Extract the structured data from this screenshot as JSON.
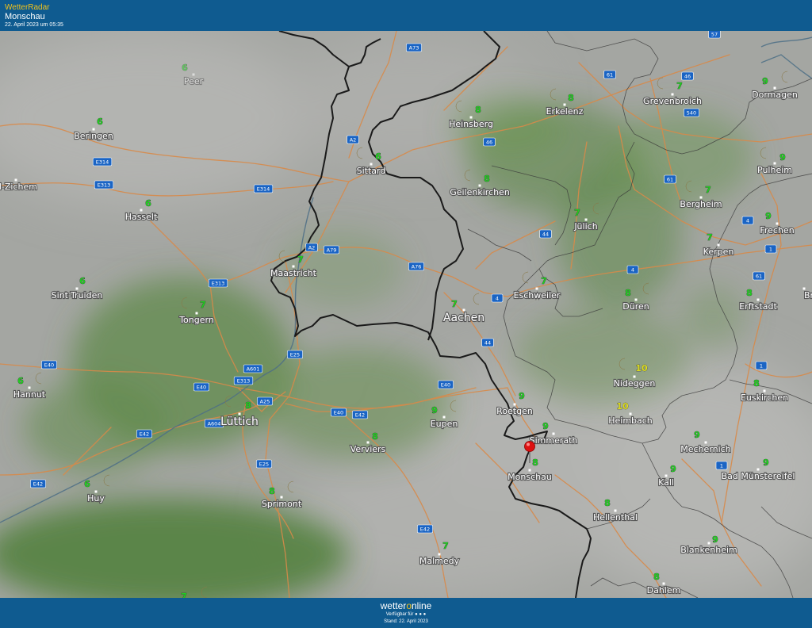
{
  "header": {
    "app_title": "WetterRadar",
    "location": "Monschau",
    "timestamp": "22. April 2023 um 05:35"
  },
  "footer": {
    "brand_prefix": "wetter",
    "brand_accent": "o",
    "brand_suffix": "nline",
    "availability": "Verfügbar für",
    "stand": "Stand: 22. April 2023"
  },
  "colors": {
    "header_bg": "#0f5b90",
    "brand_accent": "#f2c21b",
    "temp_green": "#22cc22",
    "temp_yellow": "#dddd22",
    "moon": "#f1d27a",
    "pin": "#dd1111",
    "road": "#d88a4a",
    "road_shield": "#1a64c4"
  },
  "cities": [
    {
      "name": "Peer",
      "temp": "6"
    },
    {
      "name": "Beringen",
      "temp": "6"
    },
    {
      "name": "l-Zichem",
      "temp": ""
    },
    {
      "name": "Hasselt",
      "temp": "6"
    },
    {
      "name": "Sint-Truiden",
      "temp": "6"
    },
    {
      "name": "Tongern",
      "temp": "7"
    },
    {
      "name": "Hannut",
      "temp": "6"
    },
    {
      "name": "Huy",
      "temp": "6"
    },
    {
      "name": "Lüttich",
      "temp": "8"
    },
    {
      "name": "Sprimont",
      "temp": "8"
    },
    {
      "name": "Verviers",
      "temp": "8"
    },
    {
      "name": "Maastricht",
      "temp": "7"
    },
    {
      "name": "Sittard",
      "temp": "6"
    },
    {
      "name": "Heinsberg",
      "temp": "8"
    },
    {
      "name": "Geilenkirchen",
      "temp": "8"
    },
    {
      "name": "Erkelenz",
      "temp": "8"
    },
    {
      "name": "Grevenbroich",
      "temp": "7"
    },
    {
      "name": "Dormagen",
      "temp": "9"
    },
    {
      "name": "Pulheim",
      "temp": "9"
    },
    {
      "name": "Bergheim",
      "temp": "7"
    },
    {
      "name": "Jülich",
      "temp": "7"
    },
    {
      "name": "Frechen",
      "temp": "9"
    },
    {
      "name": "Kerpen",
      "temp": "7"
    },
    {
      "name": "Aachen",
      "temp": "7"
    },
    {
      "name": "Eschweiler",
      "temp": "7"
    },
    {
      "name": "Düren",
      "temp": "8"
    },
    {
      "name": "Erftstadt",
      "temp": "8"
    },
    {
      "name": "Br",
      "temp": ""
    },
    {
      "name": "Nideggen",
      "temp": "10"
    },
    {
      "name": "Euskirchen",
      "temp": "8"
    },
    {
      "name": "Roetgen",
      "temp": "9"
    },
    {
      "name": "Eupen",
      "temp": "9"
    },
    {
      "name": "Simmerath",
      "temp": "9"
    },
    {
      "name": "Heimbach",
      "temp": "10"
    },
    {
      "name": "Monschau",
      "temp": "8"
    },
    {
      "name": "Mechernich",
      "temp": "9"
    },
    {
      "name": "Kall",
      "temp": "9"
    },
    {
      "name": "Bad Münstereifel",
      "temp": "9"
    },
    {
      "name": "Hellenthal",
      "temp": "8"
    },
    {
      "name": "Blankenheim",
      "temp": "9"
    },
    {
      "name": "Malmedy",
      "temp": "7"
    },
    {
      "name": "Dahlem",
      "temp": "8"
    },
    {
      "name": "",
      "temp": "7"
    }
  ],
  "roads": [
    "A73",
    "57",
    "61",
    "46",
    "540",
    "A2",
    "E314",
    "E313",
    "E314",
    "46",
    "61",
    "A2",
    "A79",
    "A76",
    "44",
    "4",
    "4",
    "1",
    "61",
    "E313",
    "4",
    "44",
    "E25",
    "A601",
    "E40",
    "E313",
    "A25",
    "E40",
    "E40",
    "E42",
    "A604",
    "E42",
    "E25",
    "E42",
    "E42",
    "1",
    "1",
    "E40"
  ]
}
